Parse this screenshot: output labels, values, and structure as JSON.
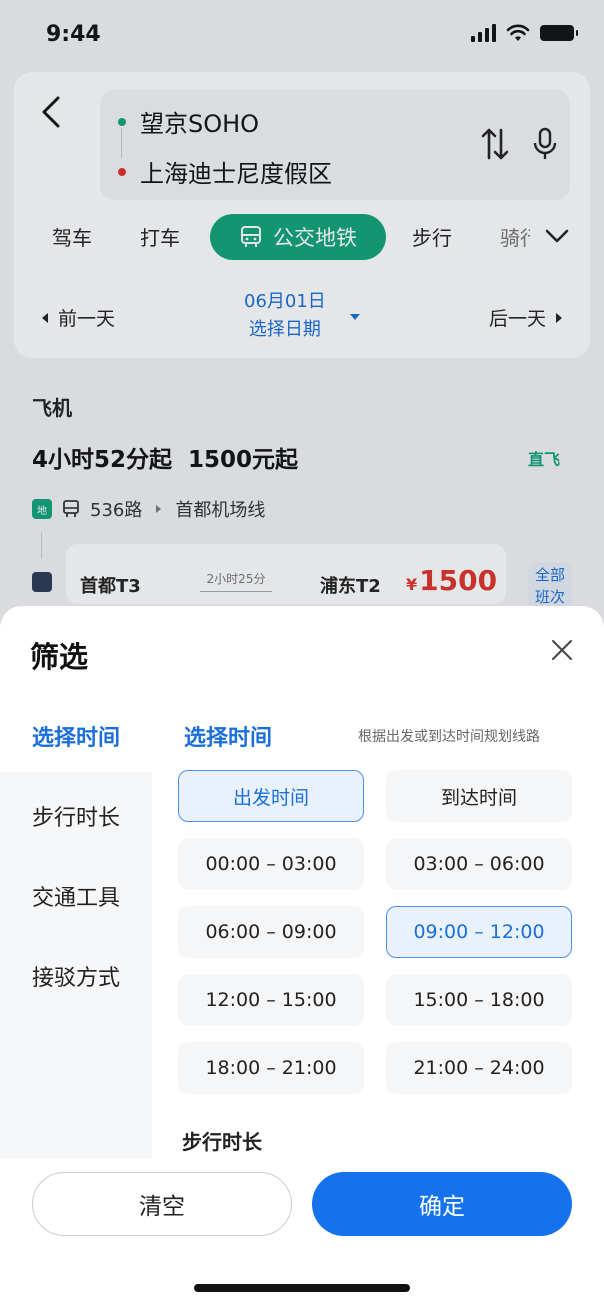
{
  "status": {
    "time": "9:44"
  },
  "route": {
    "from": "望京SOHO",
    "to": "上海迪士尼度假区"
  },
  "modes": {
    "items": [
      "驾车",
      "打车",
      "公交地铁",
      "步行",
      "骑行"
    ],
    "active_label": "公交地铁"
  },
  "date": {
    "prev": "前一天",
    "date": "06月01日",
    "select": "选择日期",
    "next": "后一天"
  },
  "flight": {
    "section": "飞机",
    "summary": "4小时52分起  1500元起",
    "badge": "直飞",
    "transit_icon": "地",
    "bus_line": "536路",
    "rail_line": "首都机场线",
    "depart": "首都T3",
    "duration": "2小时25分",
    "arrive": "浦东T2",
    "currency": "¥",
    "price": "1500",
    "all_flights": "全部班次"
  },
  "filter": {
    "title": "筛选",
    "side": [
      "选择时间",
      "步行时长",
      "交通工具",
      "接驳方式"
    ],
    "section_title": "选择时间",
    "hint": "根据出发或到达时间规划线路",
    "mode_options": [
      "出发时间",
      "到达时间"
    ],
    "slots": [
      "00:00 – 03:00",
      "03:00 – 06:00",
      "06:00 – 09:00",
      "09:00 – 12:00",
      "12:00 – 15:00",
      "15:00 – 18:00",
      "18:00 – 21:00",
      "21:00 – 24:00"
    ],
    "walk_title": "步行时长",
    "clear": "清空",
    "confirm": "确定"
  },
  "colors": {
    "accent_blue": "#1473ec",
    "transit_green": "#10a37a",
    "price_red": "#e0322c"
  }
}
